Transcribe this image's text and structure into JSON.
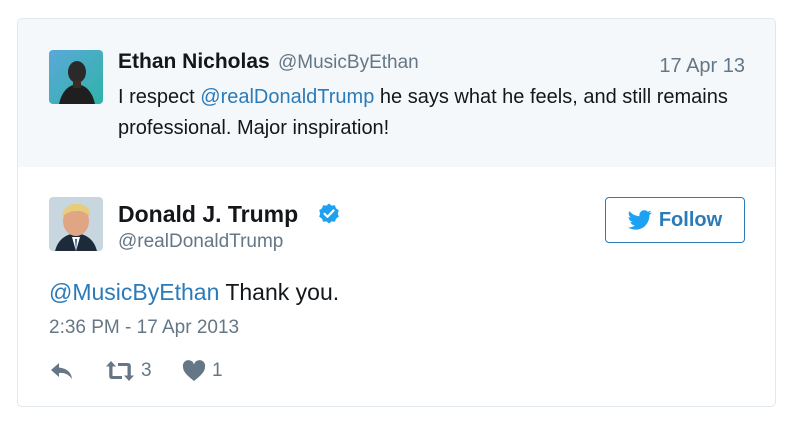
{
  "parent_tweet": {
    "name": "Ethan Nicholas",
    "handle": "@MusicByEthan",
    "date": "17 Apr 13",
    "text_prefix": "I respect ",
    "text_mention": "@realDonaldTrump",
    "text_suffix": " he says what he feels, and still remains professional. Major inspiration!"
  },
  "main_tweet": {
    "name": "Donald J. Trump",
    "handle": "@realDonaldTrump",
    "verified_icon": "verified-badge-icon",
    "text_mention": "@MusicByEthan",
    "text_body": " Thank you.",
    "timestamp": "2:36 PM - 17 Apr 2013",
    "follow_label": "Follow",
    "retweet_count": "3",
    "like_count": "1"
  },
  "icons": {
    "reply": "reply-icon",
    "retweet": "retweet-icon",
    "like": "heart-icon",
    "bird": "twitter-bird-icon"
  },
  "colors": {
    "link": "#2b7bb9",
    "verified": "#1da1f2",
    "muted": "#657786",
    "parent_background": "#f5f8fa"
  }
}
